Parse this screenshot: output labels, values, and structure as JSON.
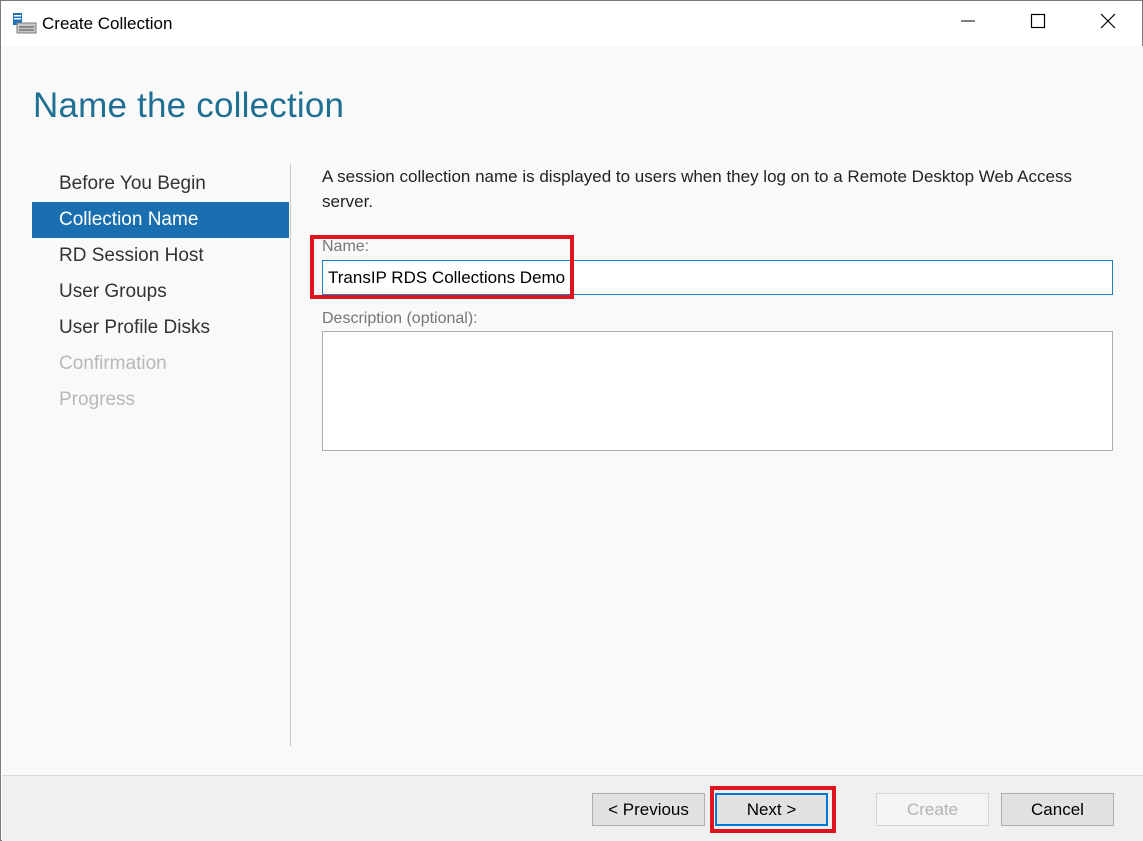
{
  "window": {
    "title": "Create Collection"
  },
  "page": {
    "heading": "Name the collection",
    "description": "A session collection name is displayed to users when they log on to a Remote Desktop Web Access server."
  },
  "nav": {
    "items": [
      {
        "label": "Before You Begin",
        "state": "normal"
      },
      {
        "label": "Collection Name",
        "state": "active"
      },
      {
        "label": "RD Session Host",
        "state": "normal"
      },
      {
        "label": "User Groups",
        "state": "normal"
      },
      {
        "label": "User Profile Disks",
        "state": "normal"
      },
      {
        "label": "Confirmation",
        "state": "disabled"
      },
      {
        "label": "Progress",
        "state": "disabled"
      }
    ]
  },
  "form": {
    "name_label": "Name:",
    "name_value": "TransIP RDS Collections Demo",
    "description_label": "Description (optional):",
    "description_value": ""
  },
  "buttons": {
    "previous": "< Previous",
    "next": "Next >",
    "create": "Create",
    "cancel": "Cancel"
  },
  "colors": {
    "accent": "#1a6fb0",
    "heading": "#1f6f94",
    "highlight": "#e0141e"
  }
}
